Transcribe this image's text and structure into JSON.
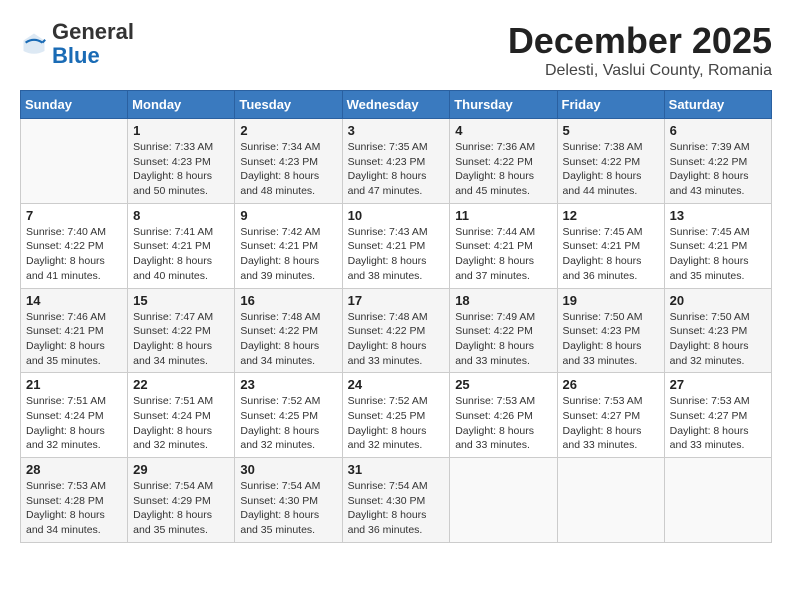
{
  "header": {
    "logo": {
      "general": "General",
      "blue": "Blue"
    },
    "title": "December 2025",
    "subtitle": "Delesti, Vaslui County, Romania"
  },
  "weekdays": [
    "Sunday",
    "Monday",
    "Tuesday",
    "Wednesday",
    "Thursday",
    "Friday",
    "Saturday"
  ],
  "weeks": [
    [
      {
        "day": "",
        "info": ""
      },
      {
        "day": "1",
        "info": "Sunrise: 7:33 AM\nSunset: 4:23 PM\nDaylight: 8 hours\nand 50 minutes."
      },
      {
        "day": "2",
        "info": "Sunrise: 7:34 AM\nSunset: 4:23 PM\nDaylight: 8 hours\nand 48 minutes."
      },
      {
        "day": "3",
        "info": "Sunrise: 7:35 AM\nSunset: 4:23 PM\nDaylight: 8 hours\nand 47 minutes."
      },
      {
        "day": "4",
        "info": "Sunrise: 7:36 AM\nSunset: 4:22 PM\nDaylight: 8 hours\nand 45 minutes."
      },
      {
        "day": "5",
        "info": "Sunrise: 7:38 AM\nSunset: 4:22 PM\nDaylight: 8 hours\nand 44 minutes."
      },
      {
        "day": "6",
        "info": "Sunrise: 7:39 AM\nSunset: 4:22 PM\nDaylight: 8 hours\nand 43 minutes."
      }
    ],
    [
      {
        "day": "7",
        "info": "Sunrise: 7:40 AM\nSunset: 4:22 PM\nDaylight: 8 hours\nand 41 minutes."
      },
      {
        "day": "8",
        "info": "Sunrise: 7:41 AM\nSunset: 4:21 PM\nDaylight: 8 hours\nand 40 minutes."
      },
      {
        "day": "9",
        "info": "Sunrise: 7:42 AM\nSunset: 4:21 PM\nDaylight: 8 hours\nand 39 minutes."
      },
      {
        "day": "10",
        "info": "Sunrise: 7:43 AM\nSunset: 4:21 PM\nDaylight: 8 hours\nand 38 minutes."
      },
      {
        "day": "11",
        "info": "Sunrise: 7:44 AM\nSunset: 4:21 PM\nDaylight: 8 hours\nand 37 minutes."
      },
      {
        "day": "12",
        "info": "Sunrise: 7:45 AM\nSunset: 4:21 PM\nDaylight: 8 hours\nand 36 minutes."
      },
      {
        "day": "13",
        "info": "Sunrise: 7:45 AM\nSunset: 4:21 PM\nDaylight: 8 hours\nand 35 minutes."
      }
    ],
    [
      {
        "day": "14",
        "info": "Sunrise: 7:46 AM\nSunset: 4:21 PM\nDaylight: 8 hours\nand 35 minutes."
      },
      {
        "day": "15",
        "info": "Sunrise: 7:47 AM\nSunset: 4:22 PM\nDaylight: 8 hours\nand 34 minutes."
      },
      {
        "day": "16",
        "info": "Sunrise: 7:48 AM\nSunset: 4:22 PM\nDaylight: 8 hours\nand 34 minutes."
      },
      {
        "day": "17",
        "info": "Sunrise: 7:48 AM\nSunset: 4:22 PM\nDaylight: 8 hours\nand 33 minutes."
      },
      {
        "day": "18",
        "info": "Sunrise: 7:49 AM\nSunset: 4:22 PM\nDaylight: 8 hours\nand 33 minutes."
      },
      {
        "day": "19",
        "info": "Sunrise: 7:50 AM\nSunset: 4:23 PM\nDaylight: 8 hours\nand 33 minutes."
      },
      {
        "day": "20",
        "info": "Sunrise: 7:50 AM\nSunset: 4:23 PM\nDaylight: 8 hours\nand 32 minutes."
      }
    ],
    [
      {
        "day": "21",
        "info": "Sunrise: 7:51 AM\nSunset: 4:24 PM\nDaylight: 8 hours\nand 32 minutes."
      },
      {
        "day": "22",
        "info": "Sunrise: 7:51 AM\nSunset: 4:24 PM\nDaylight: 8 hours\nand 32 minutes."
      },
      {
        "day": "23",
        "info": "Sunrise: 7:52 AM\nSunset: 4:25 PM\nDaylight: 8 hours\nand 32 minutes."
      },
      {
        "day": "24",
        "info": "Sunrise: 7:52 AM\nSunset: 4:25 PM\nDaylight: 8 hours\nand 32 minutes."
      },
      {
        "day": "25",
        "info": "Sunrise: 7:53 AM\nSunset: 4:26 PM\nDaylight: 8 hours\nand 33 minutes."
      },
      {
        "day": "26",
        "info": "Sunrise: 7:53 AM\nSunset: 4:27 PM\nDaylight: 8 hours\nand 33 minutes."
      },
      {
        "day": "27",
        "info": "Sunrise: 7:53 AM\nSunset: 4:27 PM\nDaylight: 8 hours\nand 33 minutes."
      }
    ],
    [
      {
        "day": "28",
        "info": "Sunrise: 7:53 AM\nSunset: 4:28 PM\nDaylight: 8 hours\nand 34 minutes."
      },
      {
        "day": "29",
        "info": "Sunrise: 7:54 AM\nSunset: 4:29 PM\nDaylight: 8 hours\nand 35 minutes."
      },
      {
        "day": "30",
        "info": "Sunrise: 7:54 AM\nSunset: 4:30 PM\nDaylight: 8 hours\nand 35 minutes."
      },
      {
        "day": "31",
        "info": "Sunrise: 7:54 AM\nSunset: 4:30 PM\nDaylight: 8 hours\nand 36 minutes."
      },
      {
        "day": "",
        "info": ""
      },
      {
        "day": "",
        "info": ""
      },
      {
        "day": "",
        "info": ""
      }
    ]
  ]
}
